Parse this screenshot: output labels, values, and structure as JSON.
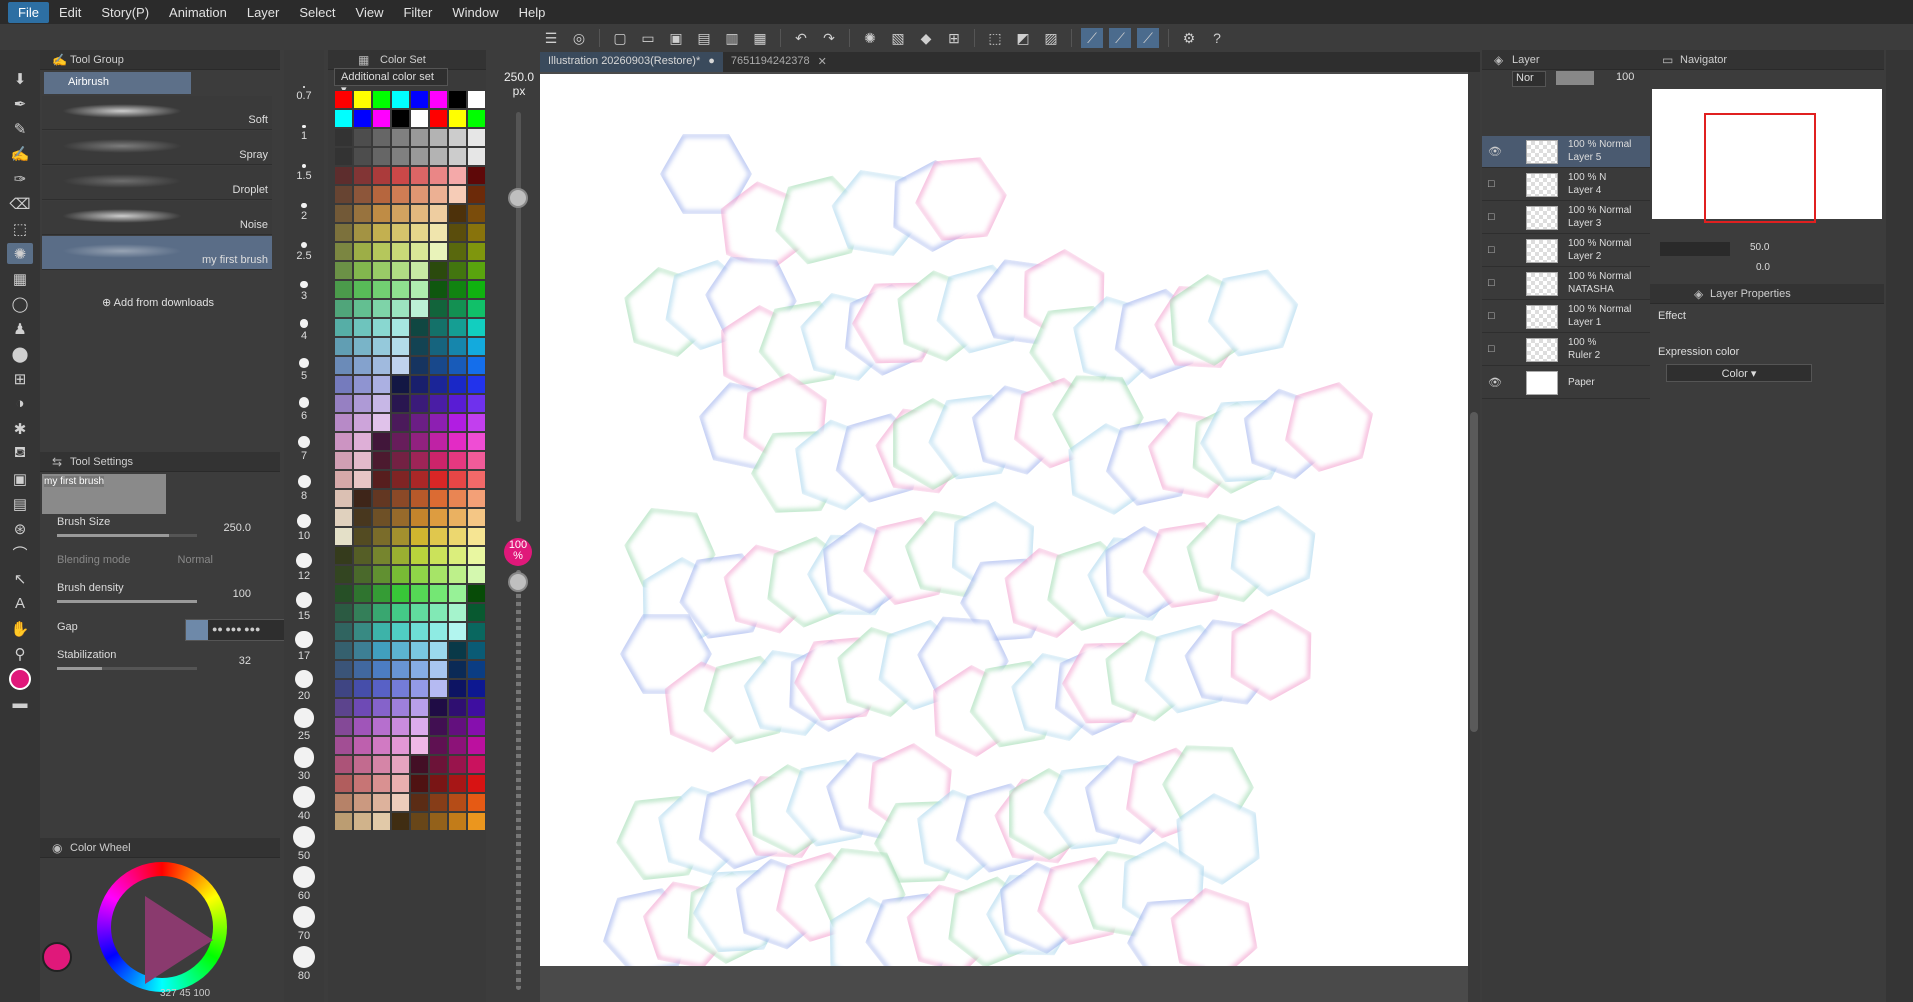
{
  "menu": [
    "File",
    "Edit",
    "Story(P)",
    "Animation",
    "Layer",
    "Select",
    "View",
    "Filter",
    "Window",
    "Help"
  ],
  "tool_group": {
    "title": "Tool Group",
    "active": "Airbrush",
    "brushes": [
      "Soft",
      "Spray",
      "Droplet",
      "Noise",
      "my first brush"
    ],
    "add_downloads": "Add from downloads"
  },
  "tool_settings": {
    "title": "Tool Settings",
    "preview_label": "my first brush",
    "brush_size_label": "Brush Size",
    "brush_size": "250.0",
    "blending_label": "Blending mode",
    "blending_value": "Normal",
    "density_label": "Brush density",
    "density": "100",
    "gap_label": "Gap",
    "stabilization_label": "Stabilization",
    "stabilization": "32"
  },
  "color_wheel": {
    "title": "Color Wheel",
    "info": "327  45  100",
    "main_color": "#e0187a"
  },
  "brush_sizes": [
    "0.7",
    "1",
    "1.5",
    "2",
    "2.5",
    "3",
    "4",
    "5",
    "6",
    "7",
    "8",
    "10",
    "12",
    "15",
    "17",
    "20",
    "25",
    "30",
    "40",
    "50",
    "60",
    "70",
    "80"
  ],
  "color_set": {
    "title": "Color Set",
    "select": "Additional color set"
  },
  "size_slider": {
    "top": "250.0",
    "unit": "px",
    "opacity": "100",
    "opacity_unit": "%"
  },
  "tabs": [
    {
      "label": "Illustration 20260903(Restore)*"
    },
    {
      "label": "7651194242378"
    }
  ],
  "layer": {
    "title": "Layer",
    "blend": "Nor",
    "opacity": "100",
    "rows": [
      {
        "line1": "100 % Normal",
        "line2": "Layer 5",
        "eye": "visible"
      },
      {
        "line1": "100 % N",
        "line2": "Layer 4",
        "eye": ""
      },
      {
        "line1": "100 % Normal",
        "line2": "Layer 3",
        "eye": ""
      },
      {
        "line1": "100 % Normal",
        "line2": "Layer 2",
        "eye": ""
      },
      {
        "line1": "100 % Normal",
        "line2": "NATASHA",
        "eye": ""
      },
      {
        "line1": "100 % Normal",
        "line2": "Layer 1",
        "eye": ""
      },
      {
        "line1": "100 %",
        "line2": "Ruler 2",
        "eye": ""
      },
      {
        "line1": "",
        "line2": "Paper",
        "eye": "visible"
      }
    ]
  },
  "navigator": {
    "title": "Navigator",
    "zoom": "50.0",
    "rotation": "0.0"
  },
  "layer_properties": {
    "title": "Layer Properties",
    "effect": "Effect",
    "expression": "Expression color",
    "expression_value": "Color"
  }
}
